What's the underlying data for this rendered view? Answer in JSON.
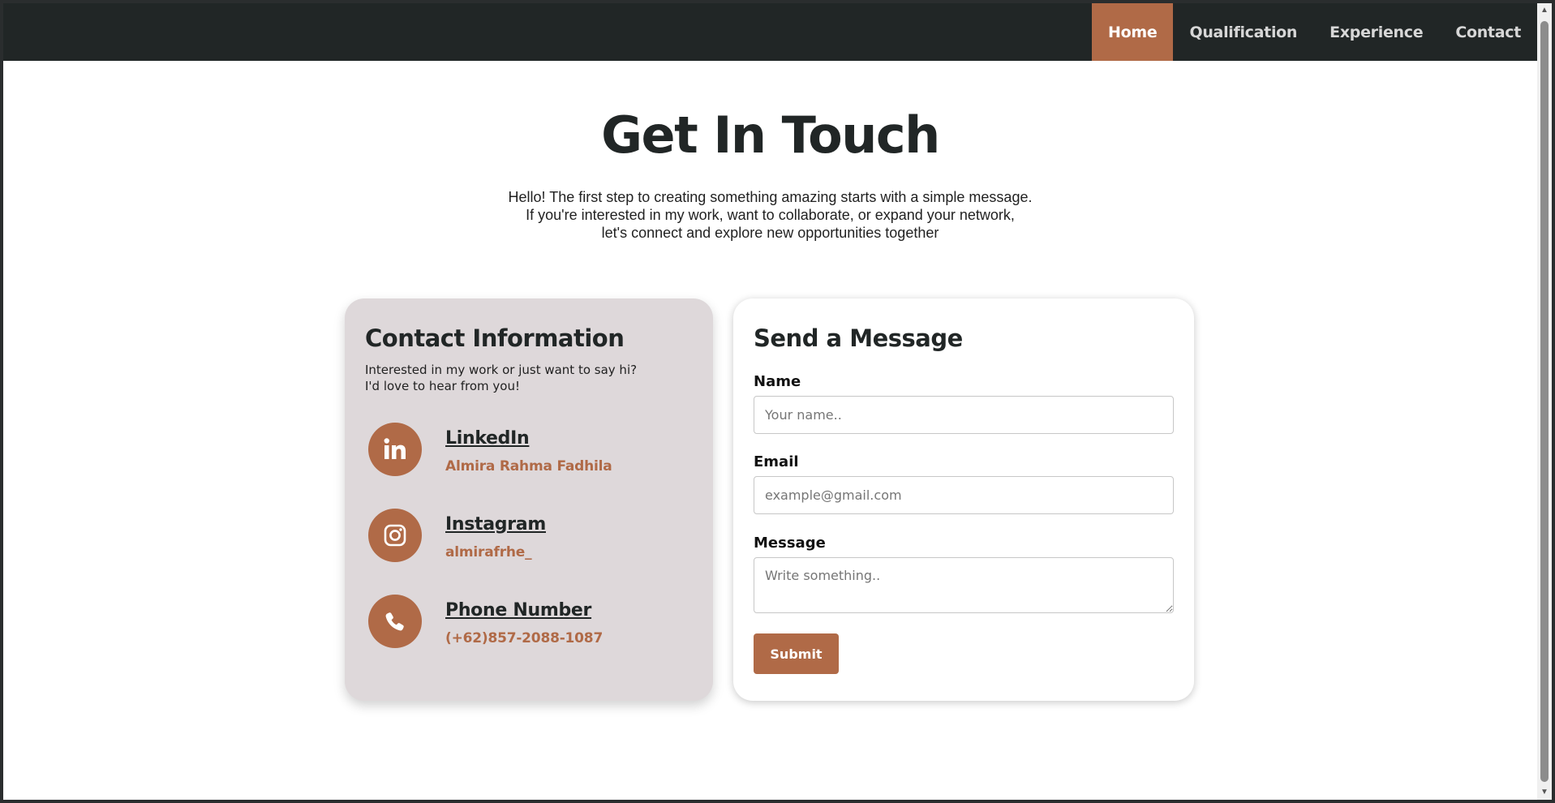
{
  "nav": {
    "items": [
      {
        "label": "Home",
        "active": true
      },
      {
        "label": "Qualification",
        "active": false
      },
      {
        "label": "Experience",
        "active": false
      },
      {
        "label": "Contact",
        "active": false
      }
    ]
  },
  "hero": {
    "title": "Get In Touch",
    "lines": [
      "Hello! The first step to creating something amazing starts with a simple message.",
      "If you're interested in my work, want to collaborate, or expand your network,",
      "let's connect and explore new opportunities together"
    ]
  },
  "contact_info": {
    "title": "Contact Information",
    "desc_lines": [
      "Interested in my work or just want to say hi?",
      "I'd love to hear from you!"
    ],
    "items": [
      {
        "icon": "linkedin-icon",
        "name": "LinkedIn",
        "value": "Almira Rahma Fadhila"
      },
      {
        "icon": "instagram-icon",
        "name": "Instagram",
        "value": "almirafrhe_"
      },
      {
        "icon": "phone-icon",
        "name": "Phone Number",
        "value": "(+62)857-2088-1087"
      }
    ]
  },
  "form": {
    "title": "Send a Message",
    "name_label": "Name",
    "name_placeholder": "Your name..",
    "email_label": "Email",
    "email_placeholder": "example@gmail.com",
    "message_label": "Message",
    "message_placeholder": "Write something..",
    "submit_label": "Submit"
  },
  "colors": {
    "accent": "#b06a47",
    "navbar": "#212626",
    "info_card": "#ded8da"
  }
}
